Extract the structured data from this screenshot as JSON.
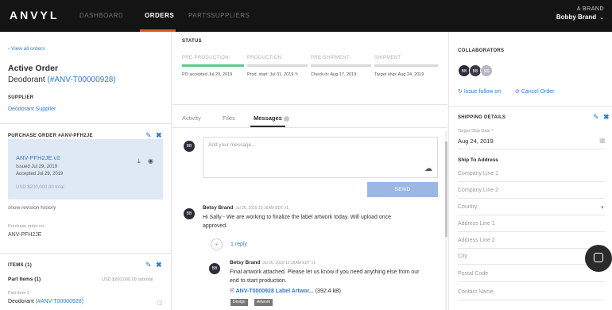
{
  "app": {
    "logo": "ANVYL"
  },
  "nav": {
    "items": [
      {
        "label": "DASHBOARD",
        "active": false
      },
      {
        "label": "ORDERS",
        "active": true
      },
      {
        "label": "PARTS",
        "active": false
      },
      {
        "label": "SUPPLIERS",
        "active": false
      }
    ],
    "brand_label": "A BRAND",
    "user_name": "Bobby Brand"
  },
  "left": {
    "back_link": "‹ View all orders",
    "heading": "Active Order",
    "product": "Deodorant",
    "order_id": "(#ANV-T00000928)",
    "supplier_label": "SUPPLIER",
    "supplier_name": "Deodorant Supplier",
    "po_header": "PURCHASE ORDER #ANV-PFH2JE",
    "po_card": {
      "version": "ANV-PFH2JE.v2",
      "issued": "Issued Jul 29, 2019",
      "accepted": "Accepted Jul 29, 2019",
      "total": "USD $200,000.00 total"
    },
    "revision_link": "show revision history",
    "po_number_label": "Purchase order no.",
    "po_number": "ANV-PFH2JE",
    "items_header": "ITEMS (1)",
    "part_items": "Part Items (1)",
    "subtotal": "USD $200,000.00 subtotal",
    "part_item_label": "Part Item 1",
    "part_item_product": "Deodorant",
    "part_item_id": "(#ANV-T00000928)"
  },
  "status": {
    "title": "STATUS",
    "stages": [
      {
        "label": "PRE-PRODUCTION",
        "done": true,
        "info": "PO accepted Jul 29, 2019"
      },
      {
        "label": "PRODUCTION",
        "done": false,
        "info": "Prod. start: Jul 31, 2019"
      },
      {
        "label": "PRE-SHIPMENT",
        "done": false,
        "info": "Check-in: Aug 17, 2019"
      },
      {
        "label": "SHIPMENT",
        "done": false,
        "info": "Target ship: Aug 24, 2019"
      }
    ]
  },
  "tabs": [
    {
      "label": "Activity",
      "active": false
    },
    {
      "label": "Files",
      "active": false
    },
    {
      "label": "Messages",
      "active": true
    }
  ],
  "composer": {
    "avatar": "BB",
    "placeholder": "Add your message...",
    "send_label": "SEND"
  },
  "messages": [
    {
      "avatar": "BB",
      "author": "Betsy Brand",
      "meta": "Jul 26, 2019 10:16AM EDT   v1",
      "body_line1": "Hi Sally - We are working to finalize the label artwork today. Will upload once",
      "body_line2": "approved.",
      "reply_label": "1 reply"
    },
    {
      "avatar": "BB",
      "author": "Betsy Brand",
      "meta": "Jul 26, 2019 10:16AM EDT   v1",
      "body_line1": "Final artwork attached. Please let us know if you need anything else from our",
      "body_line2": "end to start production.",
      "attachment_name": "ANV-T0000928 Label Artwor...",
      "attachment_size": "(392.4 kB)",
      "tags": [
        "Design",
        "Artwork"
      ]
    }
  ],
  "right": {
    "collaborators_title": "COLLABORATORS",
    "collaborators": [
      {
        "initials": "BB",
        "color": "#2d2d3a"
      },
      {
        "initials": "BB",
        "color": "#3a3a48"
      },
      {
        "initials": "SS",
        "color": "#b8b8c0"
      }
    ],
    "issue_follow_on": "Issue follow on",
    "cancel_order": "Cancel Order",
    "shipping_title": "SHIPPING DETAILS",
    "target_ship_label": "Target Ship Date *",
    "target_ship_date": "Aug 24, 2019",
    "ship_to_label": "Ship To Address",
    "fields": [
      "Company Line 1",
      "Company Line 2",
      "Country",
      "Address Line 1",
      "Address Line 2",
      "City",
      "Postal Code",
      "Contact Name"
    ]
  },
  "colors": {
    "accent": "#2f7bd4",
    "nav_active": "#e2572b",
    "progress_done": "#5cc98c"
  }
}
